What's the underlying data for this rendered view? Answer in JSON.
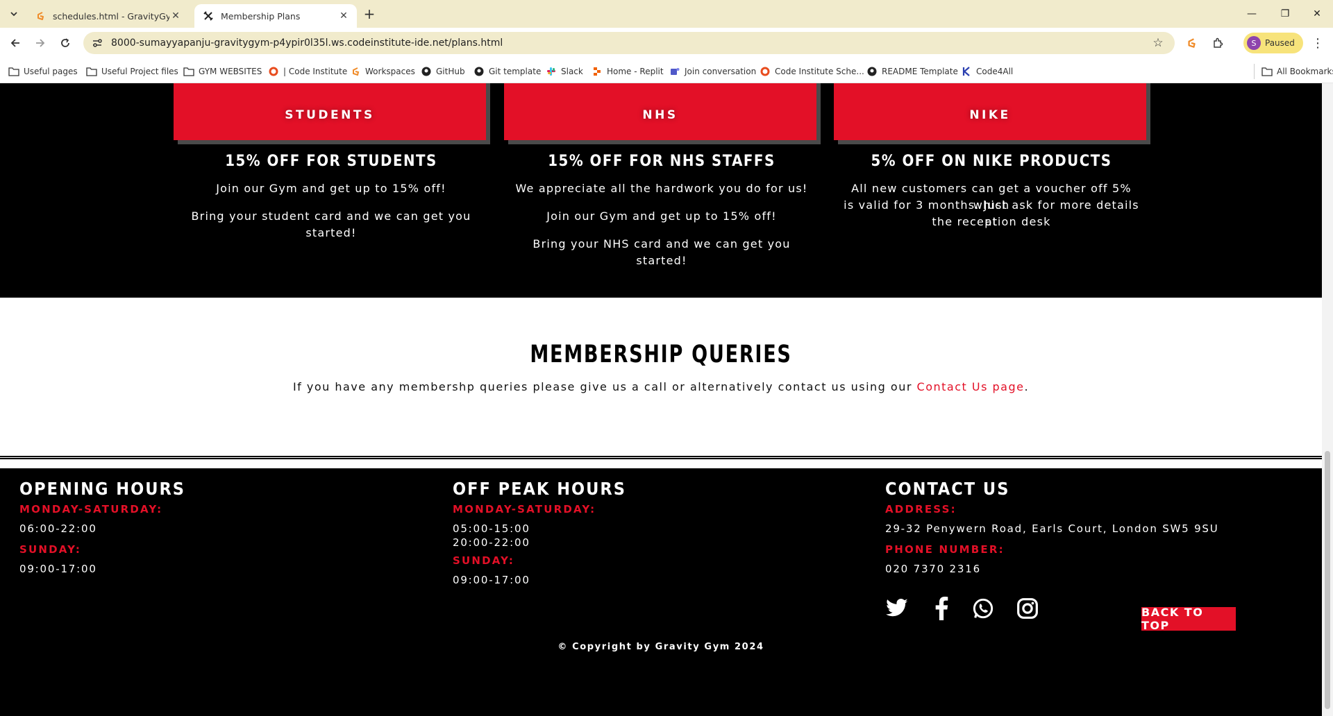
{
  "browser": {
    "tabs": [
      {
        "title": "schedules.html - GravityGym - ",
        "favicon": "gitpod-icon"
      },
      {
        "title": "Membership Plans",
        "favicon": "dumbbell-icon"
      }
    ],
    "url": "8000-sumayyapanju-gravitygym-p4ypir0l35l.ws.codeinstitute-ide.net/plans.html",
    "profile_label": "Paused",
    "profile_initial": "S"
  },
  "bookmarks": [
    {
      "label": "Useful pages",
      "icon": "folder-icon"
    },
    {
      "label": "Useful Project files",
      "icon": "folder-icon"
    },
    {
      "label": "GYM WEBSITES",
      "icon": "folder-icon"
    },
    {
      "label": "| Code Institute",
      "icon": "code-institute-icon"
    },
    {
      "label": "Workspaces",
      "icon": "gitpod-icon"
    },
    {
      "label": "GitHub",
      "icon": "github-icon"
    },
    {
      "label": "Git template",
      "icon": "github-icon"
    },
    {
      "label": "Slack",
      "icon": "slack-icon"
    },
    {
      "label": "Home - Replit",
      "icon": "replit-icon"
    },
    {
      "label": "Join conversation",
      "icon": "teams-icon"
    },
    {
      "label": "Code Institute Sche...",
      "icon": "code-institute-icon"
    },
    {
      "label": "README Template",
      "icon": "github-icon"
    },
    {
      "label": "Code4All",
      "icon": "code4all-icon"
    }
  ],
  "all_bookmarks_label": "All Bookmarks",
  "offers": [
    {
      "card": "STUDENTS",
      "title": "15% OFF FOR STUDENTS",
      "lines": [
        "Join our Gym and get up to 15% off!",
        "Bring your student card and we can get you",
        "started!"
      ]
    },
    {
      "card": "NHS",
      "title": "15% OFF FOR NHS STAFFS",
      "lines": [
        "We appreciate all the hardwork you do for us!",
        "Join our Gym and get up to 15% off!",
        "Bring your NHS card and we can get you started!"
      ]
    },
    {
      "card": "NIKE",
      "title": "5% OFF ON NIKE PRODUCTS",
      "lines": [
        "All new customers can get a voucher off 5% which",
        "is valid for 3 months. Just ask for more details at",
        "the reception desk"
      ]
    }
  ],
  "queries": {
    "title": "MEMBERSHIP QUERIES",
    "text": "If you have any membershp queries please give us a call or alternatively contact us using our ",
    "link": "Contact Us page",
    "end": "."
  },
  "footer": {
    "opening": {
      "title": "OPENING HOURS",
      "label1": "MONDAY-SATURDAY:",
      "value1": "06:00-22:00",
      "label2": "SUNDAY:",
      "value2": "09:00-17:00"
    },
    "offpeak": {
      "title": "OFF PEAK HOURS",
      "label1": "MONDAY-SATURDAY:",
      "value1a": "05:00-15:00",
      "value1b": "20:00-22:00",
      "label2": "SUNDAY:",
      "value2": "09:00-17:00"
    },
    "contact": {
      "title": "CONTACT US",
      "address_label": "ADDRESS:",
      "address": "29-32 Penywern Road, Earls Court, London SW5 9SU",
      "phone_label": "PHONE NUMBER:",
      "phone": "020 7370 2316"
    },
    "social": [
      "twitter-icon",
      "facebook-icon",
      "whatsapp-icon",
      "instagram-icon"
    ],
    "back_to_top": "BACK TO TOP",
    "copyright": "© Copyright by Gravity Gym 2024"
  },
  "colors": {
    "accent": "#e31027",
    "chrome": "#f1ebcc",
    "profile": "#f7e37b"
  }
}
